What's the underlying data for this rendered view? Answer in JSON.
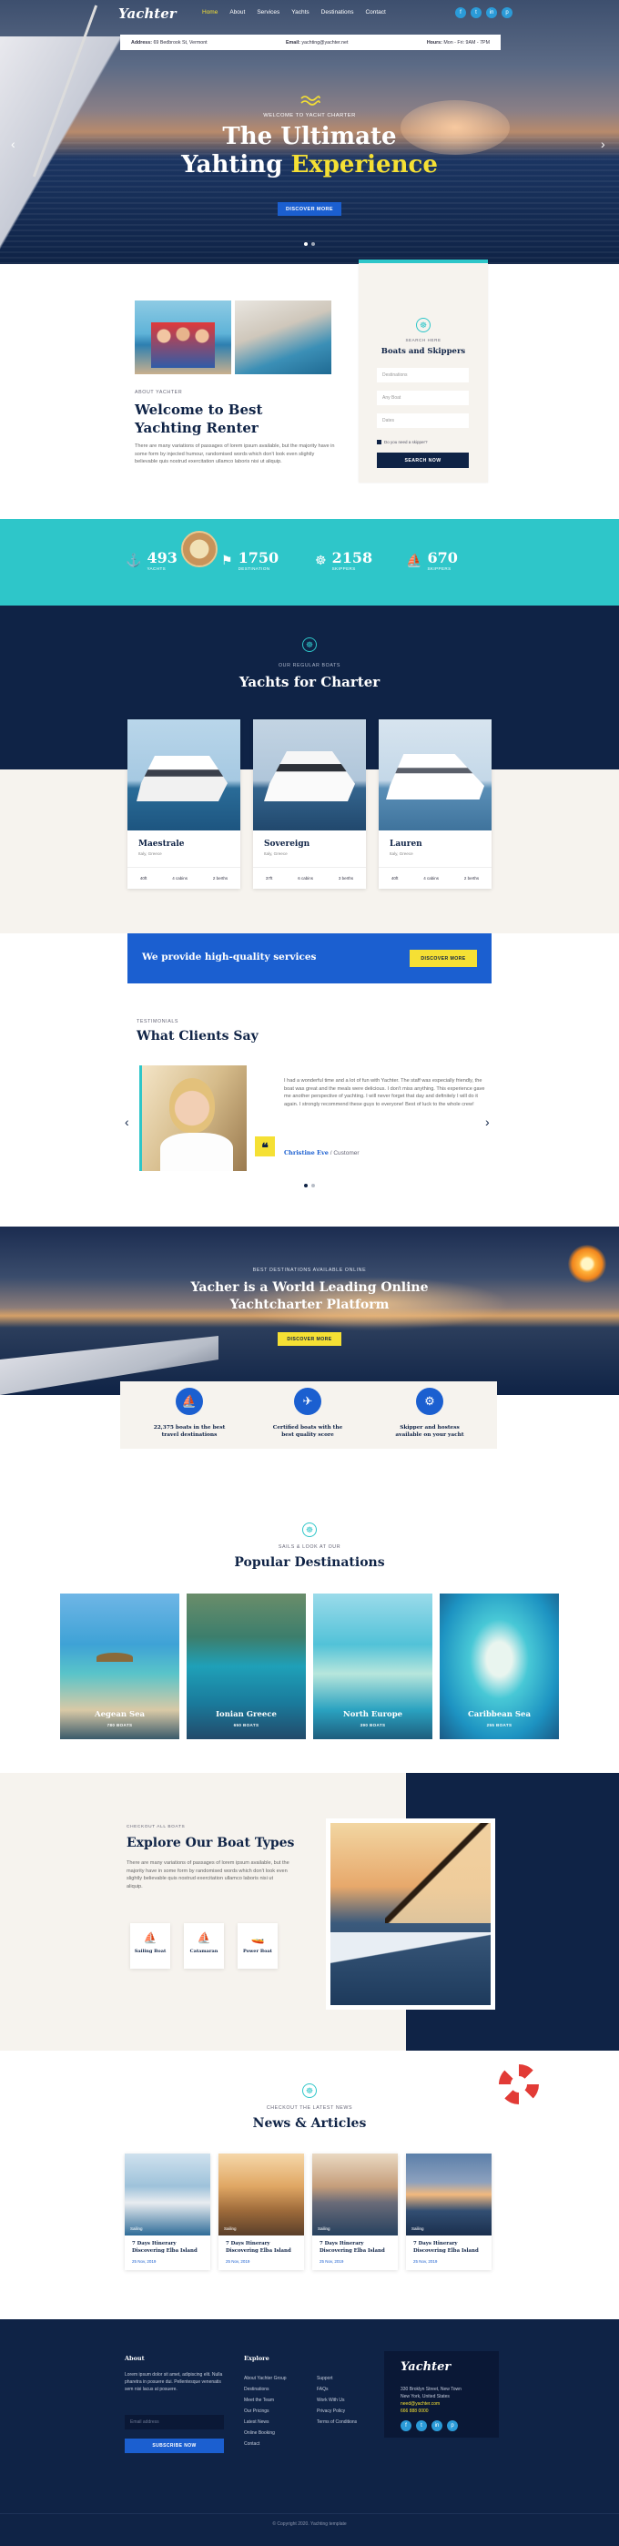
{
  "nav": {
    "logo": "Yachter",
    "links": [
      "Home",
      "About",
      "Services",
      "Yachts",
      "Destinations",
      "Contact"
    ],
    "socials": [
      "f",
      "t",
      "in",
      "p"
    ]
  },
  "infobar": {
    "address_label": "Address:",
    "address": "69 Bedbrook St, Vermont",
    "email_label": "Email:",
    "email": "yachting@yachter.net",
    "hours_label": "Hours:",
    "hours": "Mon - Fri: 9AM - 7PM"
  },
  "hero": {
    "kicker": "WELCOME TO YACHT CHARTER",
    "title_line1": "The Ultimate",
    "title_line2_a": "Yahting ",
    "title_line2_b": "Experience",
    "button": "DISCOVER MORE",
    "prev": "‹",
    "next": "›"
  },
  "about": {
    "kicker": "ABOUT YACHTER",
    "title_l1": "Welcome to Best",
    "title_l2": "Yachting Renter",
    "text": "There are many variations of passages of lorem ipsum available, but the majority have in some form by injected humour, randomised words which don't look even slightly believable quis nostrud exercitation ullamco laboris nisi ut aliquip."
  },
  "search": {
    "kicker": "SEARCH HERE",
    "title": "Boats and Skippers",
    "fields": [
      "Destinations",
      "Any Boat",
      "Dates"
    ],
    "checkbox": "Do you need a skipper?",
    "button": "SEARCH NOW"
  },
  "stats": [
    {
      "icon": "⚓",
      "num": "493",
      "lbl": "YACHTS"
    },
    {
      "icon": "⚑",
      "num": "1750",
      "lbl": "DESTINATION"
    },
    {
      "icon": "☸",
      "num": "2158",
      "lbl": "SKIPPERS"
    },
    {
      "icon": "⛵",
      "num": "670",
      "lbl": "SKIPPERS"
    }
  ],
  "charter": {
    "kicker": "OUR REGULAR BOATS",
    "title": "Yachts for Charter",
    "boats": [
      {
        "name": "Maestrale",
        "loc": "Italy, Greece",
        "s1": "40ft",
        "s2": "4 cabins",
        "s3": "2 berths"
      },
      {
        "name": "Sovereign",
        "loc": "Italy, Greece",
        "s1": "37ft",
        "s2": "6 cabins",
        "s3": "3 berths"
      },
      {
        "name": "Lauren",
        "loc": "Italy, Greece",
        "s1": "40ft",
        "s2": "4 cabins",
        "s3": "2 berths"
      }
    ]
  },
  "banner": {
    "text": "We provide high-quality services",
    "button": "DISCOVER MORE"
  },
  "testimonials": {
    "kicker": "TESTIMONIALS",
    "title": "What Clients Say",
    "quote": "I had a wonderful time and a lot of fun with Yachter. The staff was especially friendly, the boat was great and the meals were delicious. I don't miss anything. This experience gave me another perspective of yachting. I will never forget that day and definitely I will do it again. I strongly recommend these guys to everyone! Best of luck to the whole crew!",
    "name": "Christine Eve",
    "role": " / Customer",
    "prev": "‹",
    "next": "›"
  },
  "feature": {
    "kicker": "BEST DESTINATIONS AVAILABLE ONLINE",
    "title_l1": "Yacher is a World Leading Online",
    "title_l2": "Yachtcharter Platform",
    "button": "DISCOVER MORE",
    "items": [
      {
        "icon": "⛵",
        "l1": "22,375 boats in the best",
        "l2": "travel destinations"
      },
      {
        "icon": "✈",
        "l1": "Certified boats with the",
        "l2": "best quality score"
      },
      {
        "icon": "⚙",
        "l1": "Skipper and hostess",
        "l2": "available on your yacht"
      }
    ]
  },
  "destinations": {
    "kicker": "SAILS & LOOK AT OUR",
    "title": "Popular Destinations",
    "items": [
      {
        "name": "Aegean Sea",
        "count": "780 BOATS"
      },
      {
        "name": "Ionian Greece",
        "count": "650 BOATS"
      },
      {
        "name": "North Europe",
        "count": "390 BOATS"
      },
      {
        "name": "Caribbean Sea",
        "count": "255 BOATS"
      }
    ]
  },
  "boattypes": {
    "kicker": "CHECKOUT ALL BOATS",
    "title": "Explore Our Boat Types",
    "text": "There are many variations of passages of lorem ipsum available, but the majority have in some form by randomised words which don't look even slightly believable quis nostrud exercitation ullamco laboris nisi ut aliquip.",
    "types": [
      {
        "icon": "⛵",
        "label": "Sailing Boat"
      },
      {
        "icon": "⛵",
        "label": "Catamaran"
      },
      {
        "icon": "🚤",
        "label": "Power Boat"
      }
    ]
  },
  "news": {
    "kicker": "CHECKOUT THE LATEST NEWS",
    "title": "News & Articles",
    "items": [
      {
        "tag": "Sailing",
        "title": "7 Days Itinerary Discovering Elba Island",
        "date": "25 Nov, 2019"
      },
      {
        "tag": "Sailing",
        "title": "7 Days Itinerary Discovering Elba Island",
        "date": "25 Nov, 2019"
      },
      {
        "tag": "Sailing",
        "title": "7 Days Itinerary Discovering Elba Island",
        "date": "25 Nov, 2019"
      },
      {
        "tag": "Sailing",
        "title": "7 Days Itinerary Discovering Elba Island",
        "date": "25 Nov, 2019"
      }
    ]
  },
  "footer": {
    "about_h": "About",
    "about_text": "Lorem ipsum dolor sit amet, adipiscing elit. Nulla pharetra in posuere dui. Pellentesque venenatis sem nisi lacus at posuere.",
    "email_ph": "Email address",
    "subscribe": "SUBSCRIBE NOW",
    "explore_h": "Explore",
    "explore": [
      "About Yachter Group",
      "Destinations",
      "Meet the Team",
      "Our Pricings",
      "Latest News",
      "Online Booking",
      "Contact"
    ],
    "links": [
      "Support",
      "FAQs",
      "Work With Us",
      "Privacy Policy",
      "Terms of Conditions"
    ],
    "logo": "Yachter",
    "addr_l1": "330 Broklyn Street, New Town",
    "addr_l2": "New York, United States",
    "email": "need@yachter.com",
    "phone": "666 888 0000",
    "copyright": "© Copyright 2020. Yachting template"
  }
}
